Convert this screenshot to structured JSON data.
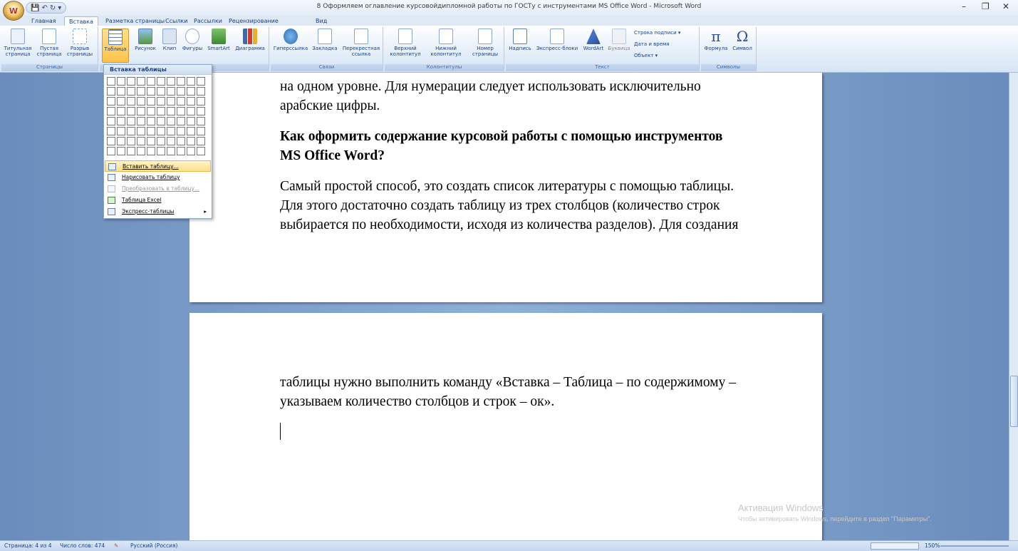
{
  "window": {
    "title": "8 Оформляем оглавление курсовойдипломной работы по ГОСТу с инструментами MS Office Word - Microsoft Word",
    "minimize": "–",
    "maximize": "❐",
    "close": "✕"
  },
  "qat": {
    "save": "💾",
    "undo": "↶",
    "redo": "↻",
    "more": "▾"
  },
  "tabs": [
    "Главная",
    "Вставка",
    "Разметка страницы",
    "Ссылки",
    "Рассылки",
    "Рецензирование",
    "Вид"
  ],
  "ribbon": {
    "groups": {
      "pages": "Страницы",
      "tables_illustr": "ии",
      "links": "Связи",
      "headers": "Колонтитулы",
      "text": "Текст",
      "symbols": "Символы"
    },
    "buttons": {
      "cover": "Титульная страница",
      "blank": "Пустая страница",
      "break": "Разрыв страницы",
      "table": "Таблица",
      "picture": "Рисунок",
      "clip": "Клип",
      "shapes": "Фигуры",
      "smartart": "SmartArt",
      "chart": "Диаграмма",
      "hyperlink": "Гиперссылка",
      "bookmark": "Закладка",
      "crossref": "Перекрестная ссылка",
      "header": "Верхний колонтитул",
      "footer": "Нижний колонтитул",
      "pagenum": "Номер страницы",
      "textbox": "Надпись",
      "quickparts": "Экспресс-блоки",
      "wordart": "WordArt",
      "dropcap": "Буквица",
      "sigline": "Строка подписи",
      "datetime": "Дата и время",
      "object": "Объект",
      "equation": "Формула",
      "symbol": "Символ"
    }
  },
  "insert_table_menu": {
    "title": "Вставка таблицы",
    "items": [
      {
        "label": "Вставить таблицу..."
      },
      {
        "label": "Нарисовать таблицу"
      },
      {
        "label": "Преобразовать в таблицу..."
      },
      {
        "label": "Таблица Excel"
      },
      {
        "label": "Экспресс-таблицы"
      }
    ]
  },
  "document": {
    "page1": {
      "line1": "на одном уровне. Для нумерации следует использовать исключительно",
      "line2": "арабские цифры.",
      "heading1": "Как оформить содержание курсовой работы с помощью инструментов",
      "heading2": "MS Office Word?",
      "para_l1": "Самый простой способ, это создать список литературы с помощью таблицы.",
      "para_l2": "Для этого достаточно создать таблицу из трех столбцов (количество строк",
      "para_l3": "выбирается по необходимости, исходя из количества разделов). Для создания"
    },
    "page2": {
      "line1": "таблицы нужно выполнить команду «Вставка – Таблица – по содержимому –",
      "line2": "указываем количество столбцов и строк – ок»."
    }
  },
  "watermark": {
    "line1": "Активация Windows",
    "line2": "Чтобы активировать Windows, перейдите в раздел \"Параметры\"."
  },
  "status": {
    "page": "Страница: 4 из 4",
    "words": "Число слов: 474",
    "language": "Русский (Россия)",
    "zoom": "150%"
  }
}
